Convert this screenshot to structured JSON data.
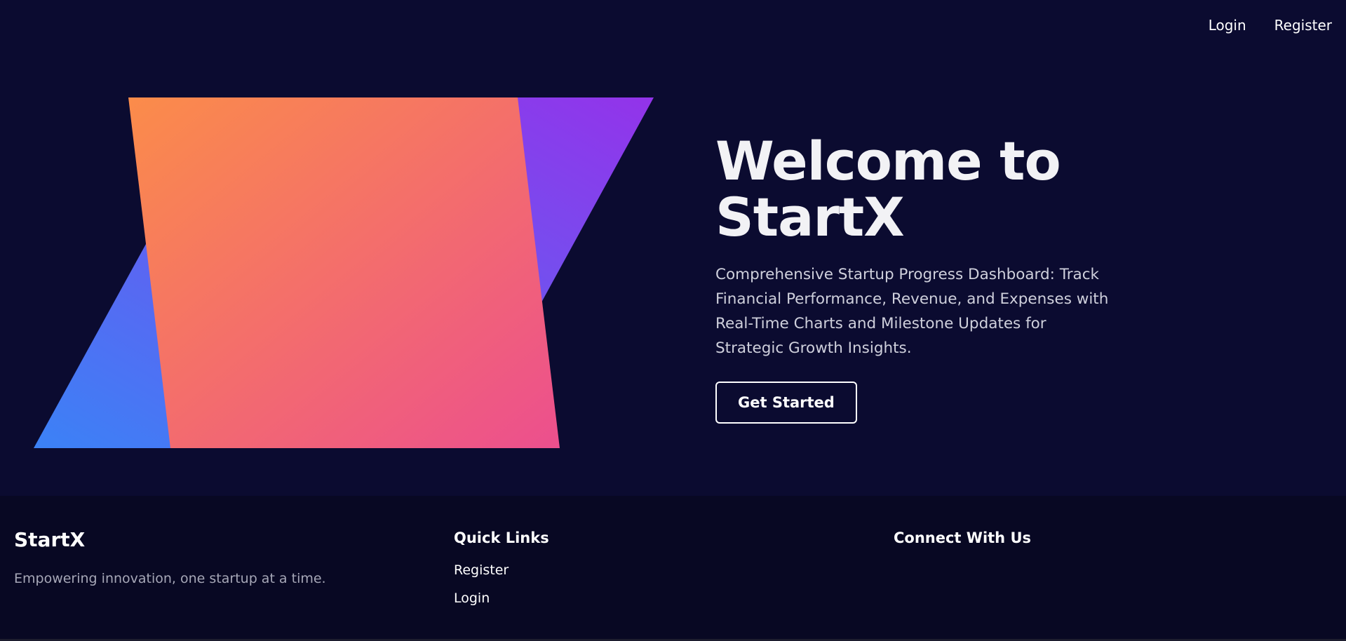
{
  "nav": {
    "login_label": "Login",
    "register_label": "Register"
  },
  "hero": {
    "title": "Welcome to StartX",
    "subtitle": "Comprehensive Startup Progress Dashboard: Track Financial Performance, Revenue, and Expenses with Real-Time Charts and Milestone Updates for Strategic Growth Insights.",
    "cta_label": "Get Started"
  },
  "footer": {
    "brand": "StartX",
    "tagline": "Empowering innovation, one startup at a time.",
    "quick_links_heading": "Quick Links",
    "quick_links": [
      "Register",
      "Login"
    ],
    "connect_heading": "Connect With Us"
  },
  "colors": {
    "background": "#0b0b30",
    "footer_background": "#080823",
    "shape_back_start": "#3b82f6",
    "shape_back_end": "#9333ea",
    "shape_front_start": "#fb8c4a",
    "shape_front_end": "#ec4f8e"
  }
}
